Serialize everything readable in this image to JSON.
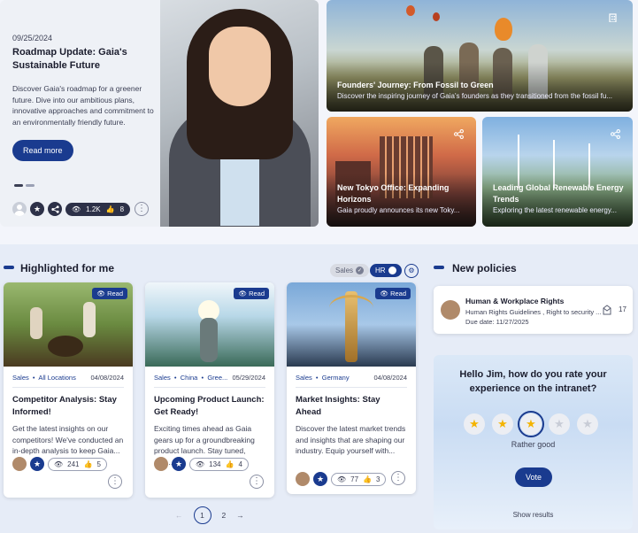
{
  "hero": {
    "date": "09/25/2024",
    "title": "Roadmap Update: Gaia's Sustainable Future",
    "description": "Discover Gaia's roadmap for a greener future. Dive into our ambitious plans, innovative approaches and commitment to an environmentally friendly future.",
    "read_more": "Read more",
    "views": "1.2K",
    "likes": "8"
  },
  "tiles": [
    {
      "title": "Founders' Journey: From Fossil to Green",
      "desc": "Discover the inspiring journey of Gaia's founders as they transitioned from the fossil fu..."
    },
    {
      "title": "New Tokyo Office: Expanding Horizons",
      "desc": "Gaia proudly announces its new Toky..."
    },
    {
      "title": "Leading Global Renewable Energy Trends",
      "desc": "Exploring the latest renewable energy..."
    }
  ],
  "highlighted": {
    "title": "Highlighted for me",
    "filter_sales": "Sales",
    "filter_hr": "HR",
    "read_label": "Read",
    "cards": [
      {
        "tag1": "Sales",
        "tag2": "All Locations",
        "date": "04/08/2024",
        "title": "Competitor Analysis: Stay Informed!",
        "desc": "Get the latest insights on our competitors! We've conducted an in-depth analysis to keep Gaia...",
        "views": "241",
        "likes": "5"
      },
      {
        "tag1": "Sales",
        "tag2": "China",
        "tag3": "Gree...",
        "date": "05/29/2024",
        "title": "Upcoming Product Launch: Get Ready!",
        "desc": "Exciting times ahead as Gaia gears up for a groundbreaking product launch. Stay tuned, and...",
        "views": "134",
        "likes": "4"
      },
      {
        "tag1": "Sales",
        "tag2": "Germany",
        "date": "04/08/2024",
        "title": "Market Insights: Stay Ahead",
        "desc": "Discover the latest market trends and insights that are shaping our industry. Equip yourself with...",
        "views": "77",
        "likes": "3"
      }
    ],
    "pagination": {
      "prev": "←",
      "pages": [
        "1",
        "2"
      ],
      "next": "→"
    }
  },
  "policies": {
    "title": "New policies",
    "item": {
      "title": "Human & Workplace Rights",
      "subtitle": "Human Rights Guidelines , Right to security ...",
      "due": "Due date: 11/27/2025",
      "count": "17"
    }
  },
  "survey": {
    "question": "Hello Jim, how do you rate your experience on the intranet?",
    "rating_label": "Rather good",
    "rating": 3,
    "max": 5,
    "vote": "Vote",
    "show_results": "Show results"
  },
  "colors": {
    "accent": "#1a3b8f",
    "star": "#f4b400"
  }
}
